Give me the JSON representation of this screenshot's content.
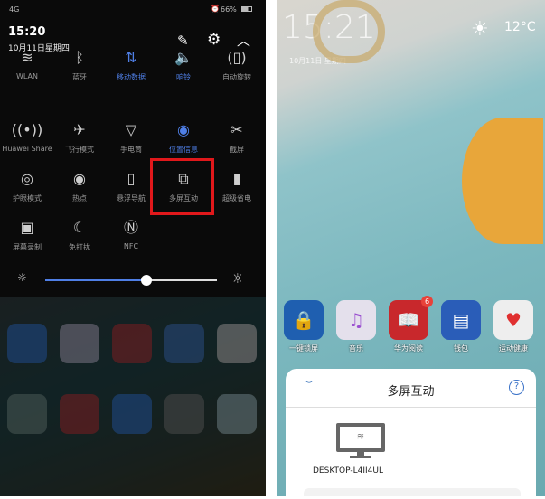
{
  "left_panel": {
    "status_bar": {
      "signal": "4G",
      "battery": "66%",
      "alarm_icon": "alarm-icon"
    },
    "time": "15:20",
    "date": "10月11日星期四",
    "header_icons": [
      "edit-icon",
      "gear-icon",
      "chevron-up-icon"
    ],
    "tiles": [
      {
        "label": "WLAN",
        "icon": "wifi-icon",
        "glyph": "≋",
        "active": false
      },
      {
        "label": "蓝牙",
        "icon": "bluetooth-icon",
        "glyph": "ᛒ",
        "active": false
      },
      {
        "label": "移动数据",
        "icon": "mobile-data-icon",
        "glyph": "⇅",
        "active": true
      },
      {
        "label": "响铃",
        "icon": "sound-icon",
        "glyph": "🔈",
        "active": true
      },
      {
        "label": "自动旋转",
        "icon": "rotate-icon",
        "glyph": "(▯)",
        "active": false
      },
      {
        "label": "Huawei Share",
        "icon": "huawei-share-icon",
        "glyph": "((•))",
        "active": false
      },
      {
        "label": "飞行模式",
        "icon": "airplane-icon",
        "glyph": "✈",
        "active": false
      },
      {
        "label": "手电筒",
        "icon": "flashlight-icon",
        "glyph": "▽",
        "active": false
      },
      {
        "label": "位置信息",
        "icon": "location-icon",
        "glyph": "◉",
        "active": true
      },
      {
        "label": "截屏",
        "icon": "screenshot-icon",
        "glyph": "✂",
        "active": false
      },
      {
        "label": "护眼模式",
        "icon": "eye-icon",
        "glyph": "◎",
        "active": false
      },
      {
        "label": "热点",
        "icon": "hotspot-icon",
        "glyph": "◉",
        "active": false
      },
      {
        "label": "悬浮导航",
        "icon": "float-nav-icon",
        "glyph": "▯",
        "active": false
      },
      {
        "label": "多屏互动",
        "icon": "multi-screen-icon",
        "glyph": "⧉",
        "active": false,
        "highlighted": true
      },
      {
        "label": "超级省电",
        "icon": "battery-saver-icon",
        "glyph": "▮",
        "active": false
      },
      {
        "label": "屏幕录制",
        "icon": "screen-record-icon",
        "glyph": "▣",
        "active": false
      },
      {
        "label": "免打扰",
        "icon": "moon-icon",
        "glyph": "☾",
        "active": false
      },
      {
        "label": "NFC",
        "icon": "nfc-icon",
        "glyph": "Ⓝ",
        "active": false
      }
    ],
    "brightness": {
      "value_percent": 59
    },
    "highlight_color": "#e0181b",
    "accent_color": "#4f7fe6"
  },
  "right_panel": {
    "clock": "15:21",
    "date": "10月11日 星期四",
    "weather": {
      "temp": "12°C",
      "icon": "sun-icon"
    },
    "apps": [
      {
        "label": "一键锁屏",
        "color": "#1f5fb0",
        "glyph": "🔒"
      },
      {
        "label": "音乐",
        "color": "#e4e0ec",
        "glyph": "♫"
      },
      {
        "label": "华为阅读",
        "color": "#c8282c",
        "glyph": "📖",
        "badge": "6"
      },
      {
        "label": "钱包",
        "color": "#2a5db8",
        "glyph": "▤"
      },
      {
        "label": "运动健康",
        "color": "#eeeeee",
        "glyph": "♥"
      }
    ],
    "sheet": {
      "title": "多屏互动",
      "help_icon": "help-icon",
      "devices": [
        {
          "name": "DESKTOP-L4II4UL",
          "icon": "monitor-wifi-icon"
        }
      ]
    }
  }
}
